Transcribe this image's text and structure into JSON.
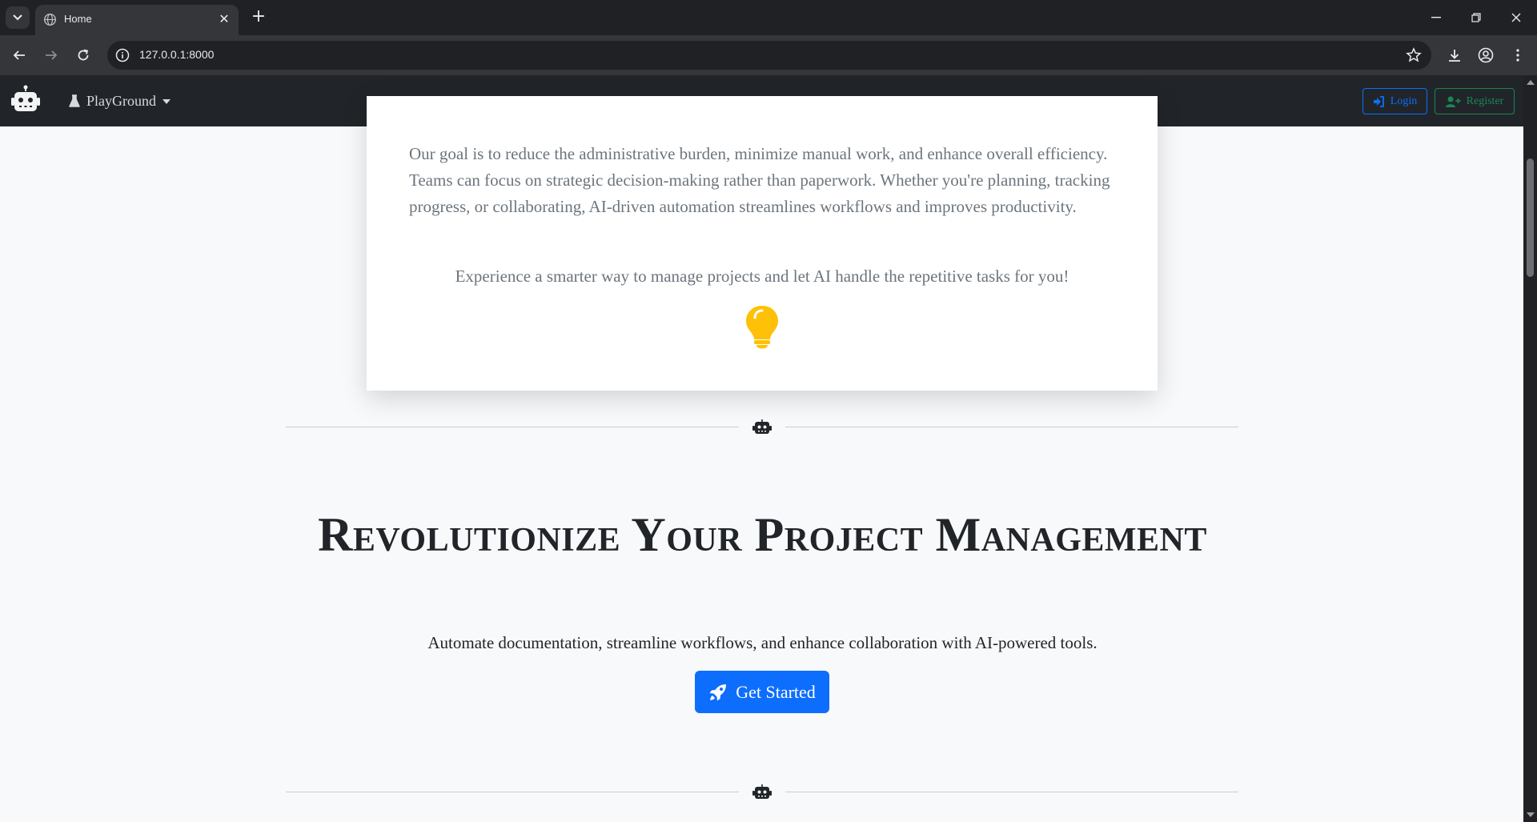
{
  "browser": {
    "tab_title": "Home",
    "url": "127.0.0.1:8000"
  },
  "nav": {
    "brand_icon": "robot-icon",
    "dropdown_label": "PlayGround",
    "login_label": "Login",
    "register_label": "Register"
  },
  "card": {
    "paragraph": "Our goal is to reduce the administrative burden, minimize manual work, and enhance overall efficiency. Teams can focus on strategic decision-making rather than paperwork. Whether you're planning, tracking progress, or collaborating, AI-driven automation streamlines workflows and improves productivity.",
    "tagline": "Experience a smarter way to manage projects and let AI handle the repetitive tasks for you!",
    "icon": "lightbulb-icon"
  },
  "hero": {
    "title": "Revolutionize Your Project Management",
    "subtitle": "Automate documentation, streamline workflows, and enhance collaboration with AI-powered tools.",
    "cta_label": "Get Started",
    "cta_icon": "rocket-icon"
  },
  "colors": {
    "navbar_bg": "#212529",
    "primary": "#0d6efd",
    "success": "#198754",
    "bulb": "#ffc107",
    "muted_text": "#6c757d"
  }
}
